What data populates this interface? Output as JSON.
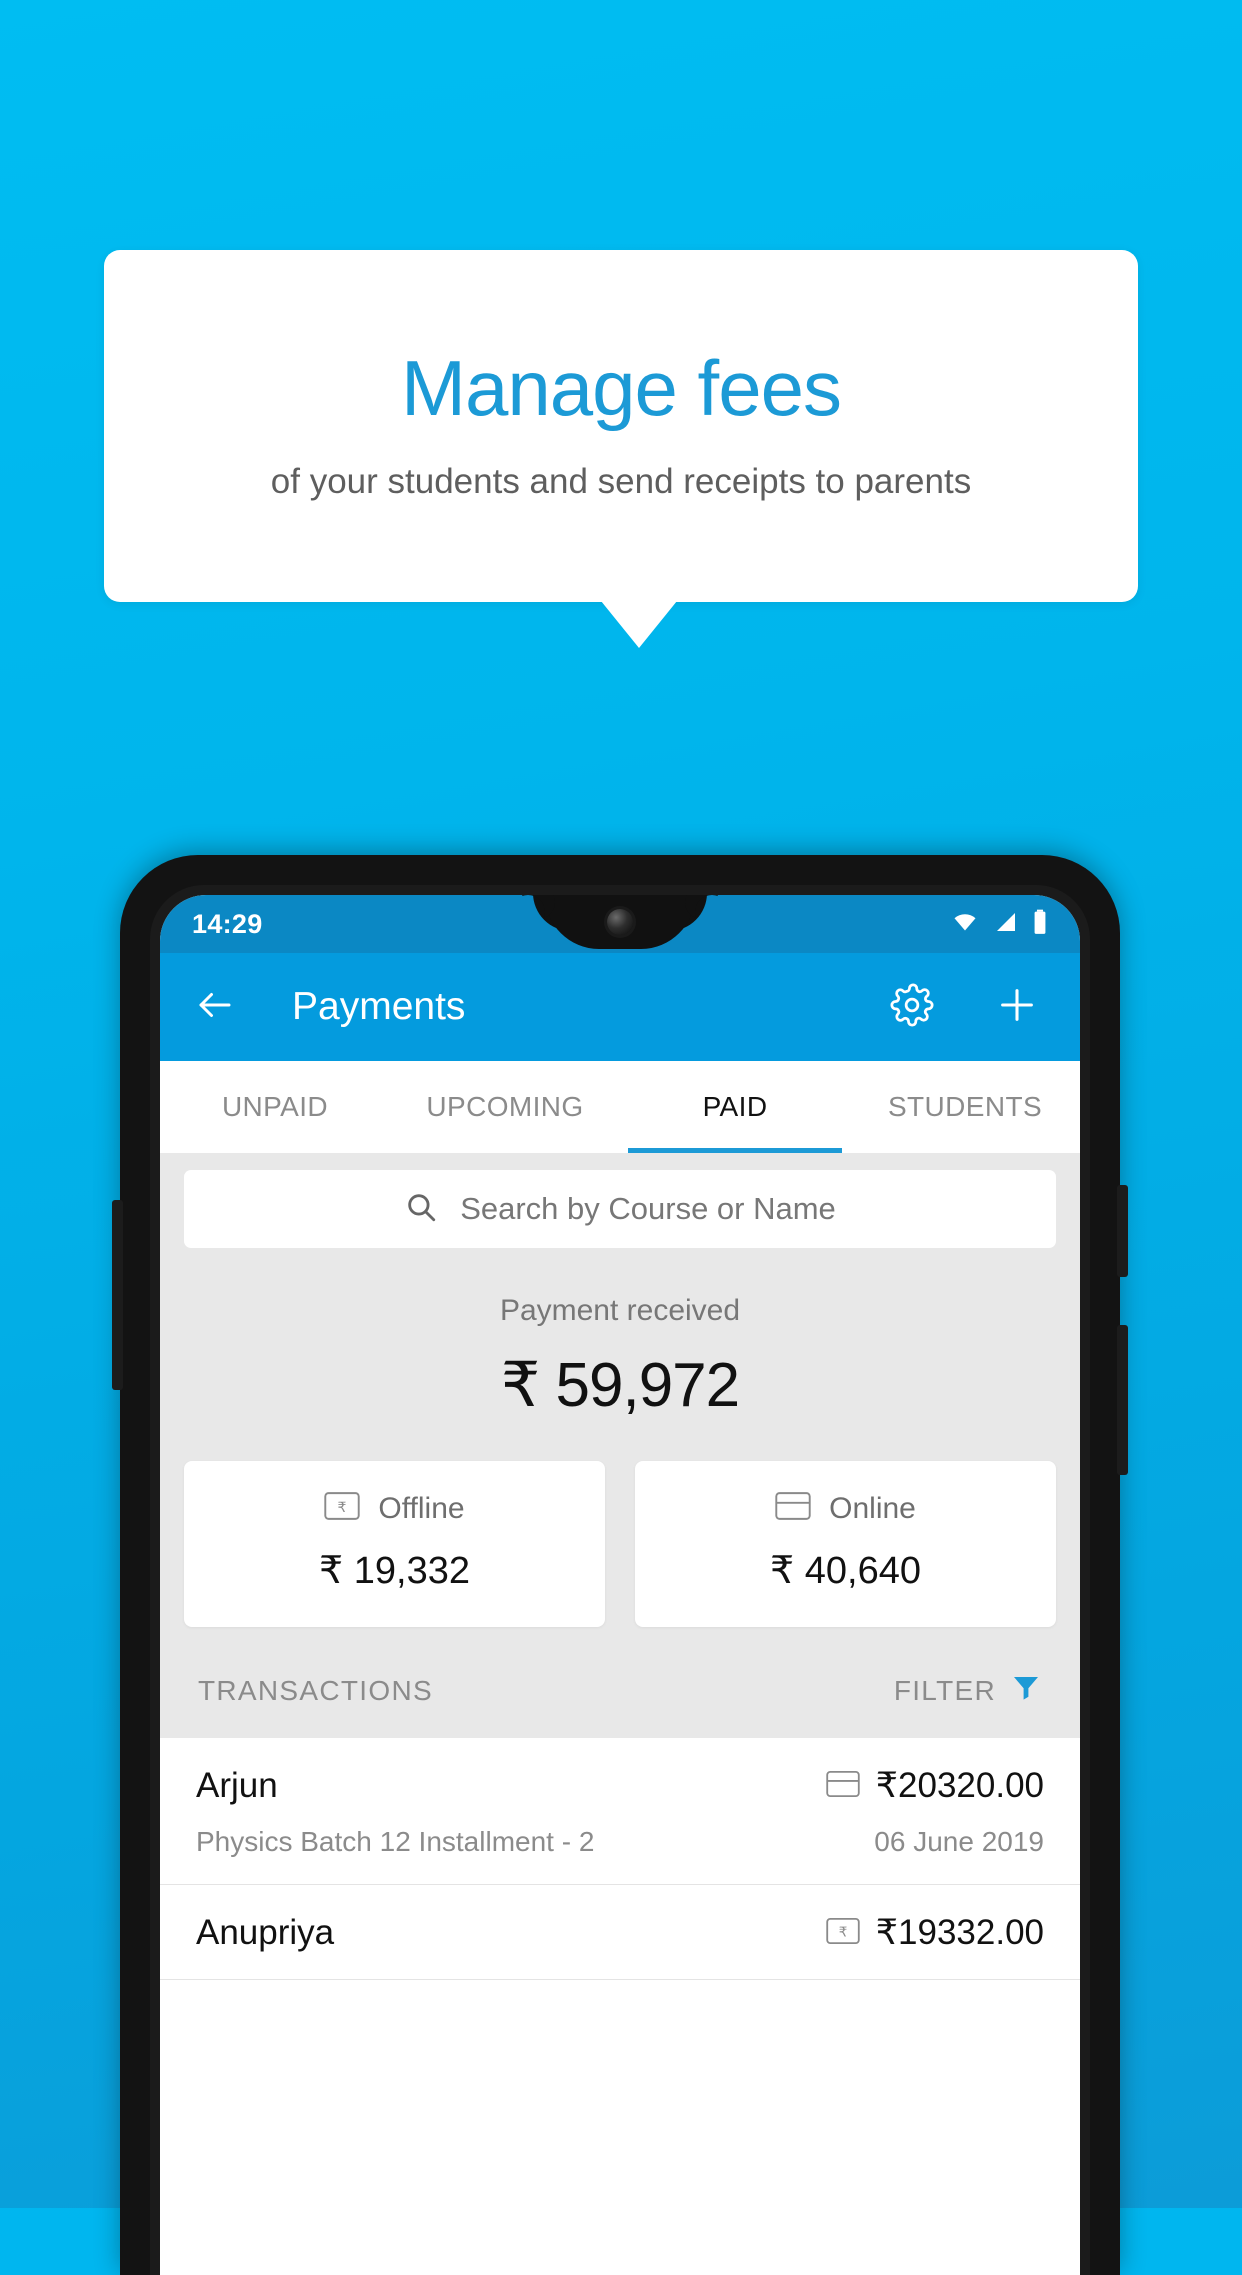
{
  "promo": {
    "title": "Manage fees",
    "subtitle": "of your students and send receipts to parents",
    "title_color": "#1C9AD6",
    "background_color": "#00B6EF"
  },
  "status_bar": {
    "time": "14:29",
    "icons": [
      "wifi-icon",
      "signal-icon",
      "battery-icon"
    ]
  },
  "app_bar": {
    "back_icon": "arrow-left-icon",
    "title": "Payments",
    "settings_icon": "gear-icon",
    "add_icon": "plus-icon",
    "color": "#049BDE"
  },
  "tabs": [
    {
      "label": "UNPAID",
      "active": false
    },
    {
      "label": "UPCOMING",
      "active": false
    },
    {
      "label": "PAID",
      "active": true
    },
    {
      "label": "STUDENTS",
      "active": false
    }
  ],
  "search": {
    "placeholder": "Search by Course or Name",
    "value": "",
    "icon": "search-icon"
  },
  "summary": {
    "label": "Payment received",
    "amount": "₹ 59,972"
  },
  "method_cards": [
    {
      "icon": "rupee-note-icon",
      "label": "Offline",
      "amount": "₹ 19,332"
    },
    {
      "icon": "credit-card-icon",
      "label": "Online",
      "amount": "₹ 40,640"
    }
  ],
  "transactions_header": {
    "title": "TRANSACTIONS",
    "filter_label": "FILTER",
    "filter_icon": "funnel-icon",
    "filter_color": "#1C9AD6"
  },
  "transactions": [
    {
      "name": "Arjun",
      "description": "Physics Batch 12 Installment - 2",
      "amount": "₹20320.00",
      "date": "06 June 2019",
      "icon": "credit-card-icon"
    },
    {
      "name": "Anupriya",
      "description": "",
      "amount": "₹19332.00",
      "date": "",
      "icon": "rupee-note-icon"
    }
  ]
}
